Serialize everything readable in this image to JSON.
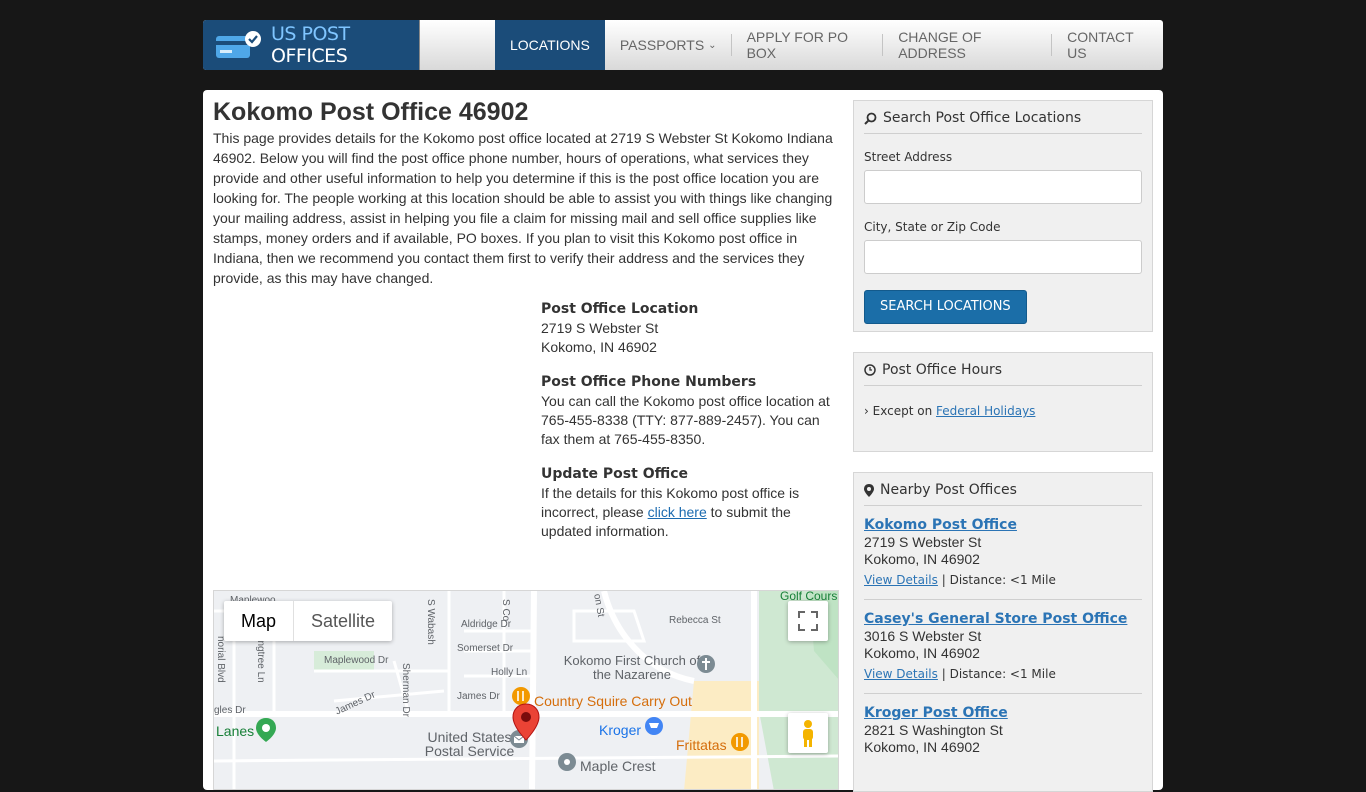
{
  "header": {
    "logo_us": "US POST",
    "logo_rest": " OFFICES",
    "nav": [
      {
        "label": "LOCATIONS"
      },
      {
        "label": "PASSPORTS"
      },
      {
        "label": "APPLY FOR PO BOX"
      },
      {
        "label": "CHANGE OF ADDRESS"
      },
      {
        "label": "CONTACT US"
      }
    ]
  },
  "page": {
    "title": "Kokomo Post Office 46902",
    "intro": "This page provides details for the Kokomo post office located at 2719 S Webster St Kokomo Indiana 46902. Below you will find the post office phone number, hours of operations, what services they provide and other useful information to help you determine if this is the post office location you are looking for. The people working at this location should be able to assist you with things like changing your mailing address, assist in helping you file a claim for missing mail and sell office supplies like stamps, money orders and if available, PO boxes. If you plan to visit this Kokomo post office in Indiana, then we recommend you contact them first to verify their address and the services they provide, as this may have changed."
  },
  "location": {
    "heading": "Post Office Location",
    "street": "2719 S Webster St",
    "city": "Kokomo, IN 46902"
  },
  "phone": {
    "heading": "Post Office Phone Numbers",
    "text": "You can call the Kokomo post office location at 765-455-8338 (TTY: 877-889-2457). You can fax them at 765-455-8350."
  },
  "update": {
    "heading": "Update Post Office",
    "before": "If the details for this Kokomo post office is incorrect, please ",
    "link": "click here",
    "after": " to submit the updated information."
  },
  "map": {
    "map_tab": "Map",
    "satellite_tab": "Satellite",
    "labels": {
      "maplewo": "Maplewoo",
      "wabash": "S Wabash",
      "s_co": "S Co",
      "aldridge": "Aldridge Dr",
      "somerset": "Somerset Dr",
      "holly": "Holly Ln",
      "maplewood": "Maplewood Dr",
      "sherman": "Sherman Dr",
      "james1": "James Dr",
      "james2": "James Dr",
      "rebecca": "Rebecca St",
      "golf": "Golf Cours",
      "arnora": "norial Blvd",
      "lingtree": "lingtree Ln",
      "gles": "gles Dr",
      "on_st": "on St"
    },
    "pois": {
      "church": "Kokomo First Church of the Nazarene",
      "country_squire": "Country Squire Carry Out",
      "kroger": "Kroger",
      "frittatas": "Frittatas",
      "usps": "United States Postal Service",
      "lanes": "Lanes",
      "maple_crest": "Maple Crest"
    }
  },
  "sidebar": {
    "search": {
      "title": "Search Post Office Locations",
      "street_label": "Street Address",
      "city_label": "City, State or Zip Code",
      "street_value": "",
      "city_value": "",
      "button": "SEARCH LOCATIONS"
    },
    "hours": {
      "title": "Post Office Hours",
      "except": "Except on ",
      "holidays_link": "Federal Holidays"
    },
    "nearby": {
      "title": "Nearby Post Offices",
      "details_link": "View Details",
      "items": [
        {
          "name": "Kokomo Post Office",
          "street": "2719 S Webster St",
          "city": "Kokomo, IN 46902",
          "distance": "Distance: <1 Mile"
        },
        {
          "name": "Casey's General Store Post Office",
          "street": "3016 S Webster St",
          "city": "Kokomo, IN 46902",
          "distance": "Distance: <1 Mile"
        },
        {
          "name": "Kroger Post Office",
          "street": "2821 S Washington St",
          "city": "Kokomo, IN 46902",
          "distance": ""
        }
      ]
    }
  },
  "colors": {
    "brand": "#1b4c79",
    "link": "#2b74b5",
    "button": "#1b6ea8"
  }
}
